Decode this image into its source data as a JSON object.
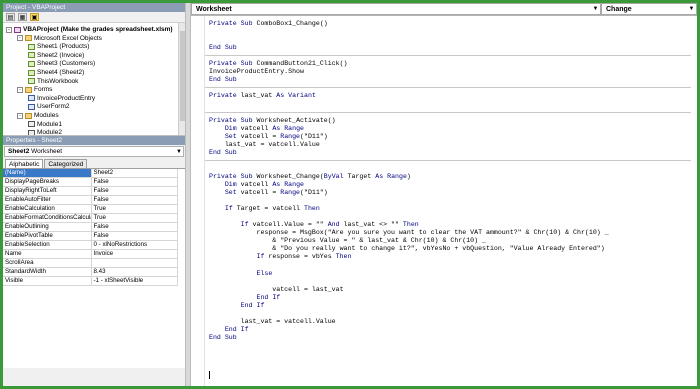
{
  "project": {
    "title": "Project - VBAProject",
    "tree": [
      {
        "label": "VBAProject (Make the grades spreadsheet.xlsm)",
        "bold": true,
        "level": 0,
        "icon": "project-icon",
        "toggle": "-"
      },
      {
        "label": "Microsoft Excel Objects",
        "level": 1,
        "icon": "folder-icon",
        "toggle": "-"
      },
      {
        "label": "Sheet1 (Products)",
        "level": 2,
        "icon": "sheet-icon"
      },
      {
        "label": "Sheet2 (Invoice)",
        "level": 2,
        "icon": "sheet-icon"
      },
      {
        "label": "Sheet3 (Customers)",
        "level": 2,
        "icon": "sheet-icon"
      },
      {
        "label": "Sheet4 (Sheet2)",
        "level": 2,
        "icon": "sheet-icon"
      },
      {
        "label": "ThisWorkbook",
        "level": 2,
        "icon": "workbook-icon"
      },
      {
        "label": "Forms",
        "level": 1,
        "icon": "folder-icon",
        "toggle": "-"
      },
      {
        "label": "InvoiceProductEntry",
        "level": 2,
        "icon": "form-icon"
      },
      {
        "label": "UserForm2",
        "level": 2,
        "icon": "form-icon"
      },
      {
        "label": "Modules",
        "level": 1,
        "icon": "folder-icon",
        "toggle": "-"
      },
      {
        "label": "Module1",
        "level": 2,
        "icon": "module-icon"
      },
      {
        "label": "Module2",
        "level": 2,
        "icon": "module-icon"
      }
    ]
  },
  "properties": {
    "title": "Properties - Sheet2",
    "object_name": "Sheet2",
    "object_type": "Worksheet",
    "tabs": [
      "Alphabetic",
      "Categorized"
    ],
    "rows": [
      [
        "(Name)",
        "Sheet2"
      ],
      [
        "DisplayPageBreaks",
        "False"
      ],
      [
        "DisplayRightToLeft",
        "False"
      ],
      [
        "EnableAutoFilter",
        "False"
      ],
      [
        "EnableCalculation",
        "True"
      ],
      [
        "EnableFormatConditionsCalculation",
        "True"
      ],
      [
        "EnableOutlining",
        "False"
      ],
      [
        "EnablePivotTable",
        "False"
      ],
      [
        "EnableSelection",
        "0 - xlNoRestrictions"
      ],
      [
        "Name",
        "Invoice"
      ],
      [
        "ScrollArea",
        ""
      ],
      [
        "StandardWidth",
        "8.43"
      ],
      [
        "Visible",
        "-1 - xlSheetVisible"
      ]
    ]
  },
  "code": {
    "object_dropdown": "Worksheet",
    "procedure_dropdown": "Change",
    "lines": [
      "Private Sub ComboBox1_Change()",
      "",
      "",
      "End Sub",
      "",
      "Private Sub CommandButton21_Click()",
      "InvoiceProductEntry.Show",
      "End Sub",
      "",
      "Private last_vat As Variant",
      "",
      "",
      "Private Sub Worksheet_Activate()",
      "    Dim vatcell As Range",
      "    Set vatcell = Range(\"D11\")",
      "    last_vat = vatcell.Value",
      "End Sub",
      "",
      "",
      "Private Sub Worksheet_Change(ByVal Target As Range)",
      "    Dim vatcell As Range",
      "    Set vatcell = Range(\"D11\")",
      "",
      "    If Target = vatcell Then",
      "",
      "        If vatcell.Value = \"\" And last_vat <> \"\" Then",
      "            response = MsgBox(\"Are you sure you want to clear the VAT ammount?\" & Chr(10) & Chr(10) _",
      "                & \"Previous Value = \" & last_vat & Chr(10) & Chr(10) _",
      "                & \"Do you really want to change it?\", vbYesNo + vbQuestion, \"Value Already Entered\")",
      "            If response = vbYes Then",
      "",
      "            Else",
      "",
      "                vatcell = last_vat",
      "            End If",
      "        End If",
      "",
      "        last_vat = vatcell.Value",
      "    End If",
      "End Sub"
    ]
  }
}
